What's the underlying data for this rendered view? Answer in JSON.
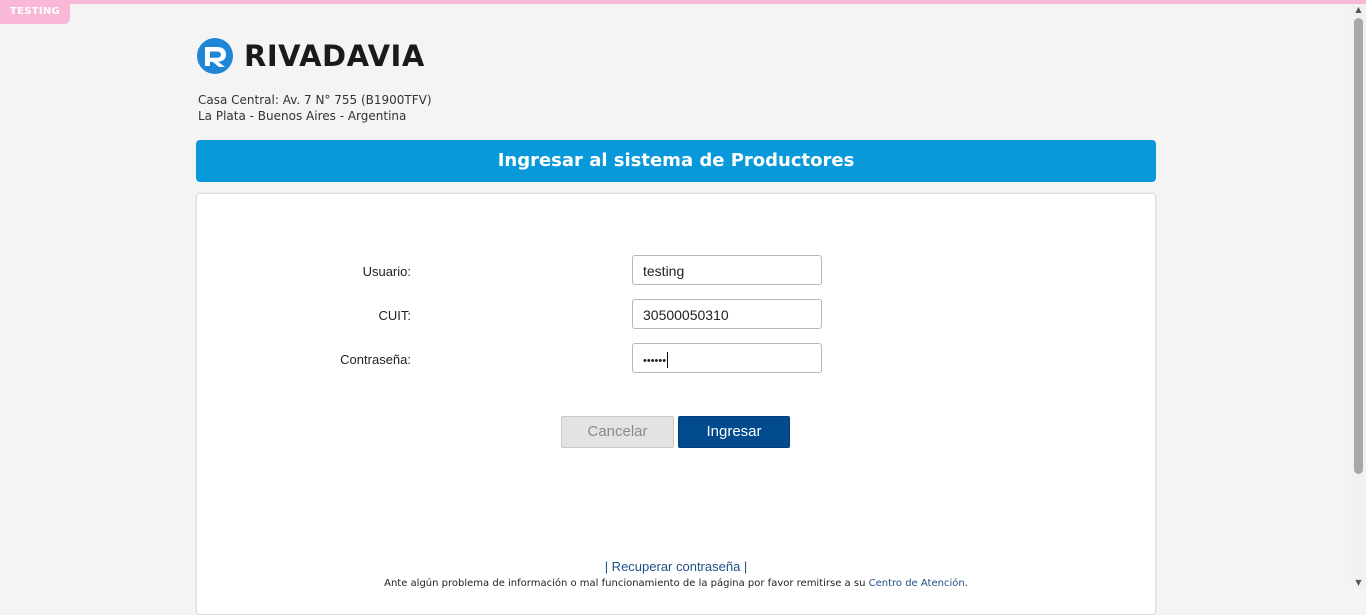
{
  "environment_badge": "TESTING",
  "brand": {
    "name": "RIVADAVIA",
    "address_line1": "Casa Central: Av. 7 N° 755 (B1900TFV)",
    "address_line2": "La Plata - Buenos Aires - Argentina"
  },
  "login": {
    "title": "Ingresar al sistema de Productores",
    "fields": {
      "usuario": {
        "label": "Usuario:",
        "value": "testing"
      },
      "cuit": {
        "label": "CUIT:",
        "value": "30500050310"
      },
      "password": {
        "label": "Contraseña:",
        "value": "••••••"
      }
    },
    "buttons": {
      "cancel": "Cancelar",
      "submit": "Ingresar"
    },
    "recover_link": "| Recuperar contraseña |",
    "help_text": "Ante algún problema de información o mal funcionamiento de la página por favor remitirse a su",
    "help_link": "Centro de Atención",
    "help_suffix": "."
  },
  "colors": {
    "brand_blue": "#0799d9",
    "button_primary": "#004a8d",
    "testing_badge": "#f9b8d8"
  }
}
